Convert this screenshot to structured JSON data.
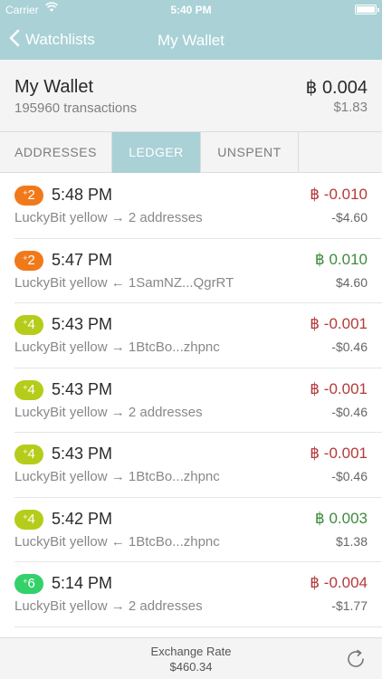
{
  "status_bar": {
    "carrier": "Carrier",
    "time": "5:40 PM"
  },
  "nav": {
    "back_label": "Watchlists",
    "title": "My Wallet"
  },
  "wallet": {
    "name": "My Wallet",
    "transactions": "195960 transactions",
    "balance": "฿ 0.004",
    "balance_usd": "$1.83"
  },
  "tabs": [
    {
      "label": "ADDRESSES",
      "selected": false
    },
    {
      "label": "LEDGER",
      "selected": true
    },
    {
      "label": "UNSPENT",
      "selected": false
    }
  ],
  "ledger": [
    {
      "badge": "2",
      "badge_color": "#f07a1a",
      "time": "5:48 PM",
      "desc": "LuckyBit yellow → 2 addresses",
      "amount": "฿ -0.010",
      "usd": "-$4.60",
      "sign": "neg"
    },
    {
      "badge": "2",
      "badge_color": "#f07a1a",
      "time": "5:47 PM",
      "desc": "LuckyBit yellow ← 1SamNZ...QgrRT",
      "amount": "฿ 0.010",
      "usd": "$4.60",
      "sign": "pos"
    },
    {
      "badge": "4",
      "badge_color": "#b6cc1a",
      "time": "5:43 PM",
      "desc": "LuckyBit yellow → 1BtcBo...zhpnc",
      "amount": "฿ -0.001",
      "usd": "-$0.46",
      "sign": "neg"
    },
    {
      "badge": "4",
      "badge_color": "#b6cc1a",
      "time": "5:43 PM",
      "desc": "LuckyBit yellow → 2 addresses",
      "amount": "฿ -0.001",
      "usd": "-$0.46",
      "sign": "neg"
    },
    {
      "badge": "4",
      "badge_color": "#b6cc1a",
      "time": "5:43 PM",
      "desc": "LuckyBit yellow → 1BtcBo...zhpnc",
      "amount": "฿ -0.001",
      "usd": "-$0.46",
      "sign": "neg"
    },
    {
      "badge": "4",
      "badge_color": "#b6cc1a",
      "time": "5:42 PM",
      "desc": "LuckyBit yellow ← 1BtcBo...zhpnc",
      "amount": "฿ 0.003",
      "usd": "$1.38",
      "sign": "pos"
    },
    {
      "badge": "6",
      "badge_color": "#34d06a",
      "time": "5:14 PM",
      "desc": "LuckyBit yellow → 2 addresses",
      "amount": "฿ -0.004",
      "usd": "-$1.77",
      "sign": "neg"
    }
  ],
  "footer": {
    "label": "Exchange Rate",
    "rate": "$460.34"
  }
}
